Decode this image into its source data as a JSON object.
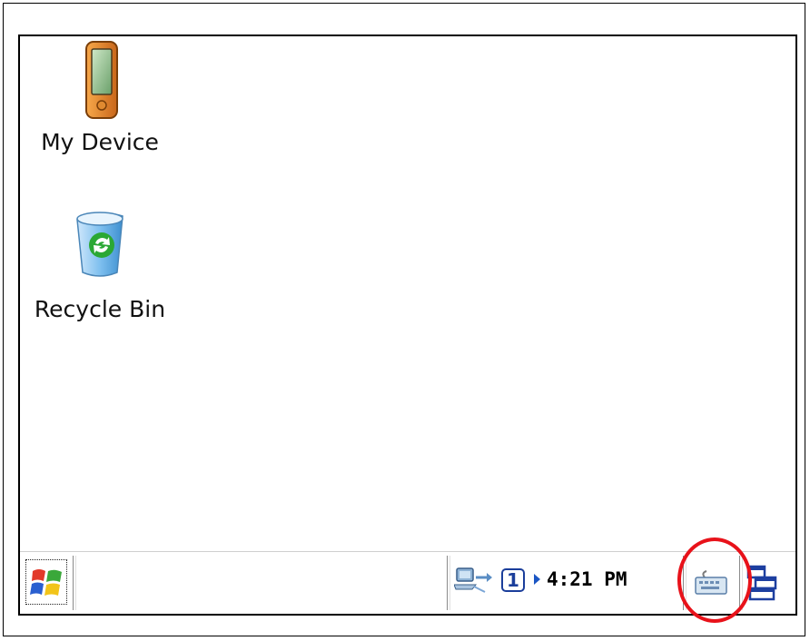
{
  "desktop": {
    "icons": [
      {
        "name": "my-device",
        "label": "My Device",
        "icon": "pocket-pc-device-icon"
      },
      {
        "name": "recycle-bin",
        "label": "Recycle Bin",
        "icon": "recycle-bin-icon"
      }
    ]
  },
  "taskbar": {
    "start_icon": "windows-flag-icon",
    "tray": {
      "network_icon": "network-connection-icon",
      "input_indicator": "1",
      "clock": "4:21 PM",
      "keyboard_icon": "soft-keyboard-icon",
      "desktop_icon": "show-desktop-icon"
    }
  },
  "colors": {
    "highlight": "#e8121a",
    "tray_blue": "#1b3e9b"
  }
}
